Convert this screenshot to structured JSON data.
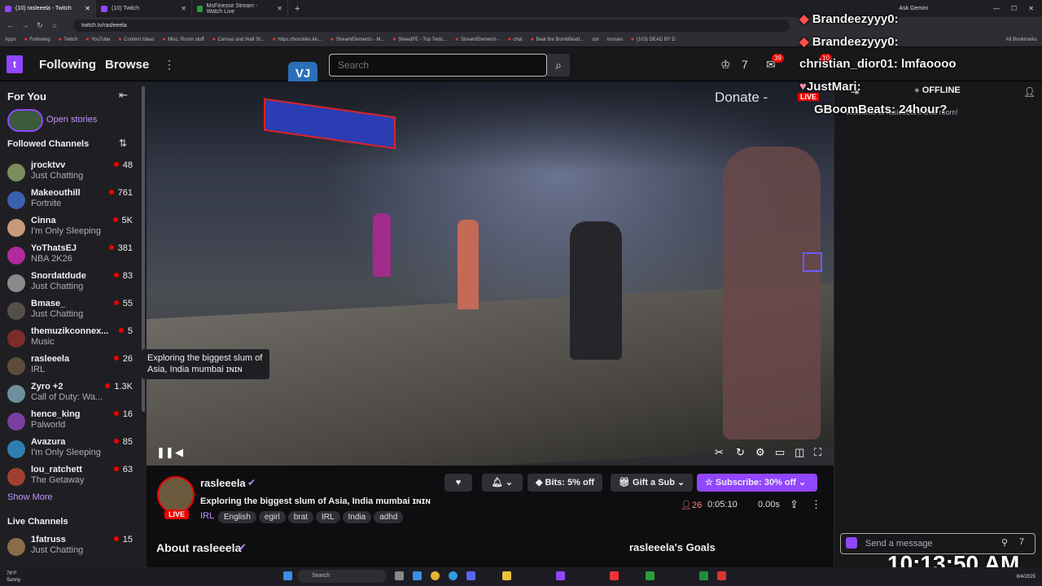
{
  "browser": {
    "tabs": [
      {
        "title": "(10) rasleeela - Twitch",
        "active": true
      },
      {
        "title": "(10) Twitch",
        "active": false
      },
      {
        "title": "MsFinesse Stream - Watch Live",
        "active": false
      }
    ],
    "url": "twitch.tv/rasleeela",
    "bookmarks": [
      "Apps",
      "Following",
      "Twitch",
      "YouTube",
      "Content Ideas",
      "Misc. Room stuff",
      "Canvas and Wall St...",
      "https://bounties.kic...",
      "StreamElements - M...",
      "SheedFE - Top Twitc...",
      "StreamElements -",
      "chat",
      "Beat the BombBeatt...",
      "oor",
      "houses",
      "(103) DEAD BY D",
      "All Bookmarks"
    ],
    "gemini_label": "Ask Gemini"
  },
  "nav": {
    "following": "Following",
    "browse": "Browse",
    "search_placeholder": "Search",
    "ext_badge": "VJ",
    "notif_count1": "39",
    "notif_count2": "10"
  },
  "sidebar": {
    "for_you": "For You",
    "open_stories": "Open stories",
    "followed_header": "Followed Channels",
    "channels": [
      {
        "name": "jrocktvv",
        "game": "Just Chatting",
        "viewers": "48"
      },
      {
        "name": "Makeouthill",
        "game": "Fortnite",
        "viewers": "761"
      },
      {
        "name": "Cinna",
        "game": "I'm Only Sleeping",
        "viewers": "5K"
      },
      {
        "name": "YoThatsEJ",
        "game": "NBA 2K26",
        "viewers": "381"
      },
      {
        "name": "Snordatdude",
        "game": "Just Chatting",
        "viewers": "83"
      },
      {
        "name": "Bmase_",
        "game": "Just Chatting",
        "viewers": "55"
      },
      {
        "name": "themuzikconnex...",
        "game": "Music",
        "viewers": "5"
      },
      {
        "name": "rasleeela",
        "game": "IRL",
        "viewers": "26"
      },
      {
        "name": "Zyro +2",
        "game": "Call of Duty: Wa...",
        "viewers": "1.3K"
      },
      {
        "name": "hence_king",
        "game": "Palworld",
        "viewers": "16"
      },
      {
        "name": "Avazura",
        "game": "I'm Only Sleeping",
        "viewers": "85"
      },
      {
        "name": "lou_ratchett",
        "game": "The Getaway",
        "viewers": "63"
      }
    ],
    "show_more": "Show More",
    "live_header": "Live Channels",
    "live_channels": [
      {
        "name": "1fatruss",
        "game": "Just Chatting",
        "viewers": "15"
      }
    ]
  },
  "video": {
    "tooltip": "Exploring the biggest slum of Asia, India mumbai ɪɴɪɴ",
    "donate": "Donate -"
  },
  "stream": {
    "channel": "rasleeela",
    "title": "Exploring the biggest slum of Asia, India mumbai ɪɴɪɴ",
    "live": "LIVE",
    "category": "IRL",
    "tags": [
      "English",
      "egirl",
      "brat",
      "IRL",
      "India",
      "adhd"
    ],
    "bits": "Bits: 5% off",
    "gift": "Gift a Sub",
    "subscribe": "Subscribe: 30% off",
    "viewers": "26",
    "uptime": "0:05:10",
    "latency": "0.00s",
    "about": "About rasleeela",
    "goals": "rasleeela's Goals"
  },
  "chat": {
    "offline": "OFFLINE",
    "welcome": "Welcome to rasleeela's chat room!",
    "send_placeholder": "Send a message"
  },
  "overlay": {
    "messages": [
      {
        "user": "Brandeezyyy0:",
        "text": ""
      },
      {
        "user": "Brandeezyyy0:",
        "text": ""
      },
      {
        "user": "christian_dior01:",
        "text": "lmfaoooo"
      },
      {
        "user": "JustMari:",
        "text": ""
      },
      {
        "user": "GBoomBeats:",
        "text": "24hour?"
      }
    ],
    "live_tag": "LIVE",
    "clock": "10:13:50 AM"
  },
  "taskbar": {
    "weather_temp": "76°F",
    "weather_desc": "Sunny",
    "search": "Search",
    "date": "8/4/2025"
  }
}
